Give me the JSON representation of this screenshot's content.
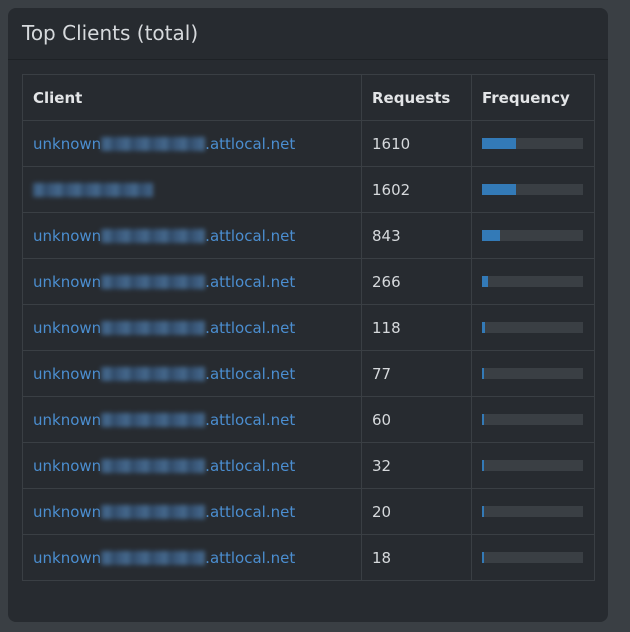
{
  "panel": {
    "title": "Top Clients (total)"
  },
  "table": {
    "headers": {
      "client": "Client",
      "requests": "Requests",
      "frequency": "Frequency"
    },
    "rows": [
      {
        "client_prefix": "unknown",
        "client_suffix": ".attlocal.net",
        "requests": "1610",
        "frequency_pct": 33.7
      },
      {
        "client_prefix": "",
        "client_suffix": "",
        "requests": "1602",
        "frequency_pct": 33.6
      },
      {
        "client_prefix": "unknown",
        "client_suffix": ".attlocal.net",
        "requests": "843",
        "frequency_pct": 17.7
      },
      {
        "client_prefix": "unknown",
        "client_suffix": ".attlocal.net",
        "requests": "266",
        "frequency_pct": 5.6
      },
      {
        "client_prefix": "unknown",
        "client_suffix": ".attlocal.net",
        "requests": "118",
        "frequency_pct": 2.5
      },
      {
        "client_prefix": "unknown",
        "client_suffix": ".attlocal.net",
        "requests": "77",
        "frequency_pct": 1.6
      },
      {
        "client_prefix": "unknown",
        "client_suffix": ".attlocal.net",
        "requests": "60",
        "frequency_pct": 1.3
      },
      {
        "client_prefix": "unknown",
        "client_suffix": ".attlocal.net",
        "requests": "32",
        "frequency_pct": 0.7
      },
      {
        "client_prefix": "unknown",
        "client_suffix": ".attlocal.net",
        "requests": "20",
        "frequency_pct": 0.4
      },
      {
        "client_prefix": "unknown",
        "client_suffix": ".attlocal.net",
        "requests": "18",
        "frequency_pct": 0.4
      }
    ]
  },
  "colors": {
    "panel_bg": "#272b30",
    "page_bg": "#3a3f44",
    "link": "#4b8ed0",
    "bar_fill": "#337ab7",
    "bar_track": "#3a3f44"
  }
}
